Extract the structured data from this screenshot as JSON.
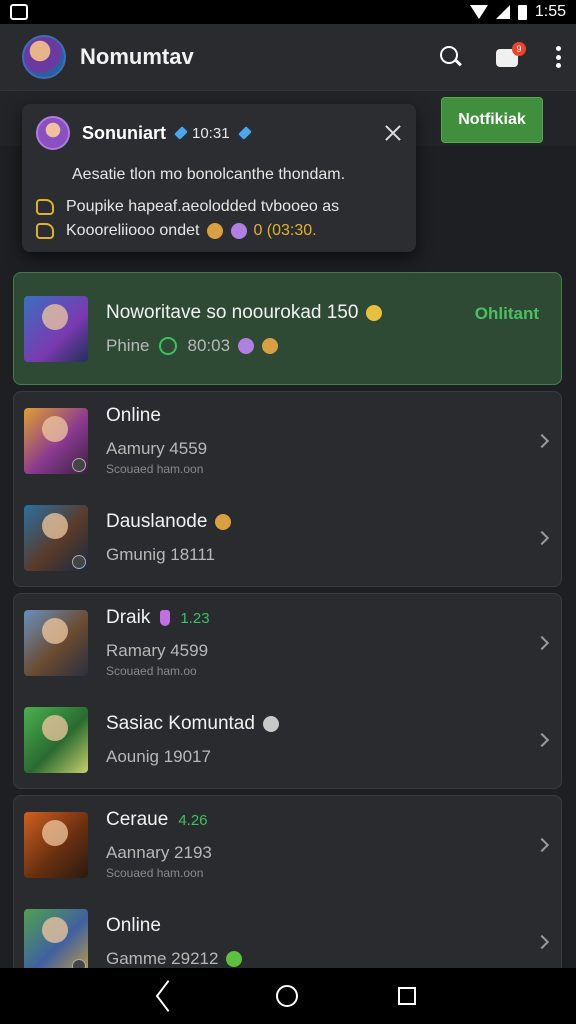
{
  "status_bar": {
    "time": "1:55"
  },
  "app_bar": {
    "title": "Nomumtav",
    "chat_badge": "9"
  },
  "notify_button": {
    "label": "Notfikiak"
  },
  "toast": {
    "name": "Sonuniart",
    "time": "10:31",
    "message": "Aesatie tlon mo bonolcanthe thondam.",
    "line1": "Poupike hapeaf.aeolodded tvbooeo as",
    "line2": "Koooreliiooo ondet",
    "line2_tail": "0 (03:30."
  },
  "highlight": {
    "title": "Noworitave so noourokad 150",
    "status": "Ohlitant",
    "sub": "Phine",
    "code": "80:03"
  },
  "items": [
    {
      "title": "Online",
      "sub": "Aamury 4559",
      "note": "Scouaed ham.oon",
      "icons": [
        "helmet",
        "ghost"
      ]
    },
    {
      "title": "Dauslanode",
      "sub": "Gmunig 18111",
      "note": "",
      "icons": [
        "helmet",
        "sword"
      ]
    },
    {
      "title": "Draik",
      "badge": "1.23",
      "sub": "Ramary 4599",
      "note": "Scouaed ham.oo",
      "icons": [
        "potion"
      ]
    },
    {
      "title": "Sasiac Komuntad",
      "sub": "Aounig 19017",
      "note": "",
      "icons": [
        "coin"
      ]
    },
    {
      "title": "Ceraue",
      "badge": "4.26",
      "sub": "Aannary 2193",
      "note": "Scouaed ham.oon",
      "icons": []
    },
    {
      "title": "Online",
      "sub": "Gamme 29212",
      "note": "",
      "icons": [
        "leaf"
      ]
    }
  ],
  "nav": {
    "back": "back-icon",
    "home": "home-icon",
    "recent": "recent-icon"
  }
}
